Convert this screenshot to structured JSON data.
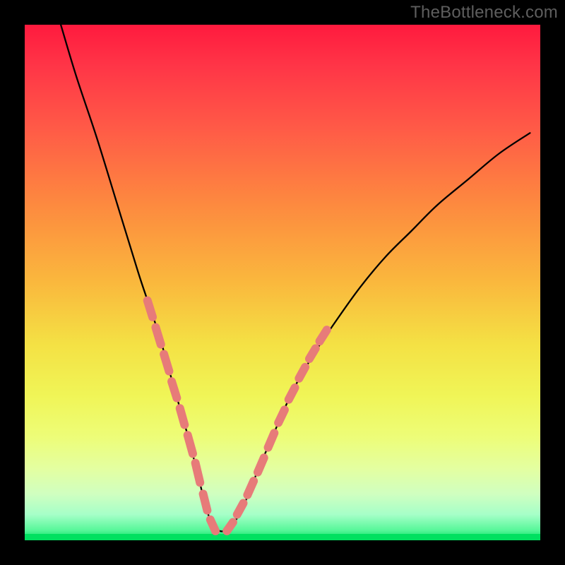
{
  "watermark": "TheBottleneck.com",
  "chart_data": {
    "type": "line",
    "title": "",
    "xlabel": "",
    "ylabel": "",
    "xlim": [
      0,
      100
    ],
    "ylim": [
      0,
      100
    ],
    "grid": false,
    "legend": false,
    "series": [
      {
        "name": "curve",
        "style": "black-line",
        "x": [
          7,
          10,
          14,
          18,
          22,
          24,
          26,
          28,
          30,
          32,
          33,
          34,
          35,
          36,
          37.5,
          39,
          41,
          43,
          45,
          48,
          52,
          56,
          60,
          65,
          70,
          75,
          80,
          86,
          92,
          98
        ],
        "y": [
          100,
          90,
          78,
          65,
          52,
          46,
          40,
          33,
          26,
          19,
          15,
          11,
          7,
          4,
          2,
          2,
          4,
          8,
          13,
          20,
          29,
          36,
          42,
          49,
          55,
          60,
          65,
          70,
          75,
          79
        ]
      },
      {
        "name": "highlight-dashes-left",
        "style": "pink-dash",
        "segments": [
          {
            "x": [
              23.8,
              24.8
            ],
            "y": [
              46.5,
              43.3
            ]
          },
          {
            "x": [
              25.4,
              26.4
            ],
            "y": [
              41.3,
              38.0
            ]
          },
          {
            "x": [
              27.0,
              28.0
            ],
            "y": [
              36.1,
              32.8
            ]
          },
          {
            "x": [
              28.5,
              29.5
            ],
            "y": [
              30.8,
              27.6
            ]
          },
          {
            "x": [
              30.1,
              31.0
            ],
            "y": [
              25.6,
              22.4
            ]
          },
          {
            "x": [
              31.6,
              32.6
            ],
            "y": [
              20.4,
              16.8
            ]
          },
          {
            "x": [
              33.1,
              34.0
            ],
            "y": [
              15.0,
              11.2
            ]
          },
          {
            "x": [
              34.6,
              35.4
            ],
            "y": [
              9.0,
              5.8
            ]
          },
          {
            "x": [
              36.0,
              37.0
            ],
            "y": [
              4.0,
              1.8
            ]
          }
        ]
      },
      {
        "name": "highlight-dashes-right",
        "style": "pink-dash",
        "segments": [
          {
            "x": [
              39.2,
              40.4
            ],
            "y": [
              1.8,
              3.5
            ]
          },
          {
            "x": [
              41.2,
              42.4
            ],
            "y": [
              5.0,
              7.2
            ]
          },
          {
            "x": [
              43.2,
              44.4
            ],
            "y": [
              8.8,
              11.5
            ]
          },
          {
            "x": [
              45.2,
              46.4
            ],
            "y": [
              13.2,
              16.0
            ]
          },
          {
            "x": [
              47.2,
              48.4
            ],
            "y": [
              18.0,
              20.8
            ]
          },
          {
            "x": [
              49.2,
              50.4
            ],
            "y": [
              22.8,
              25.3
            ]
          },
          {
            "x": [
              51.2,
              52.4
            ],
            "y": [
              27.3,
              29.6
            ]
          },
          {
            "x": [
              53.2,
              54.4
            ],
            "y": [
              31.4,
              33.6
            ]
          },
          {
            "x": [
              55.2,
              56.4
            ],
            "y": [
              35.2,
              37.2
            ]
          },
          {
            "x": [
              57.2,
              58.6
            ],
            "y": [
              38.6,
              40.8
            ]
          }
        ]
      }
    ],
    "annotations": []
  }
}
